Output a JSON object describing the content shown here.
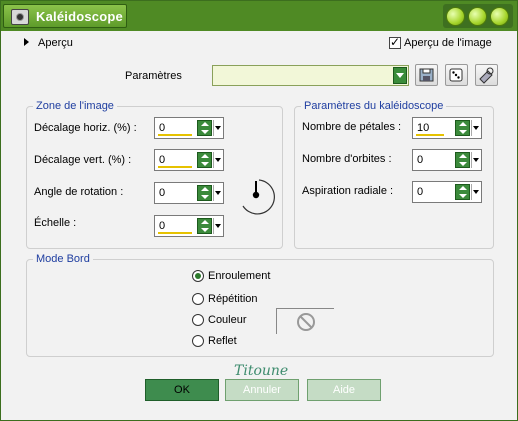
{
  "window": {
    "title": "Kaléidoscope"
  },
  "preview": {
    "expander_label": "Aperçu",
    "checkbox_label": "Aperçu de l'image"
  },
  "presets": {
    "label": "Paramètres",
    "value": ""
  },
  "zone": {
    "title": "Zone de l'image",
    "fields": [
      {
        "label": "Décalage horiz. (%) :",
        "value": "0"
      },
      {
        "label": "Décalage vert. (%) :",
        "value": "0"
      },
      {
        "label": "Angle de rotation :",
        "value": "0"
      },
      {
        "label": "Échelle :",
        "value": "0"
      }
    ]
  },
  "kaleido": {
    "title": "Paramètres du kaléidoscope",
    "fields": [
      {
        "label": "Nombre de pétales :",
        "value": "10"
      },
      {
        "label": "Nombre d'orbites :",
        "value": "0"
      },
      {
        "label": "Aspiration radiale :",
        "value": "0"
      }
    ]
  },
  "mode_bord": {
    "title": "Mode Bord",
    "options": [
      {
        "label": "Enroulement",
        "selected": true
      },
      {
        "label": "Répétition",
        "selected": false
      },
      {
        "label": "Couleur",
        "selected": false
      },
      {
        "label": "Reflet",
        "selected": false
      }
    ]
  },
  "watermark": "Titoune",
  "buttons": {
    "ok": "OK",
    "cancel": "Annuler",
    "help": "Aide"
  },
  "colors": {
    "titlebar": "#4f8a24",
    "accent_green": "#3e8c4e",
    "group_title": "#1f3ea0",
    "spin_bar": "#e6c200"
  }
}
